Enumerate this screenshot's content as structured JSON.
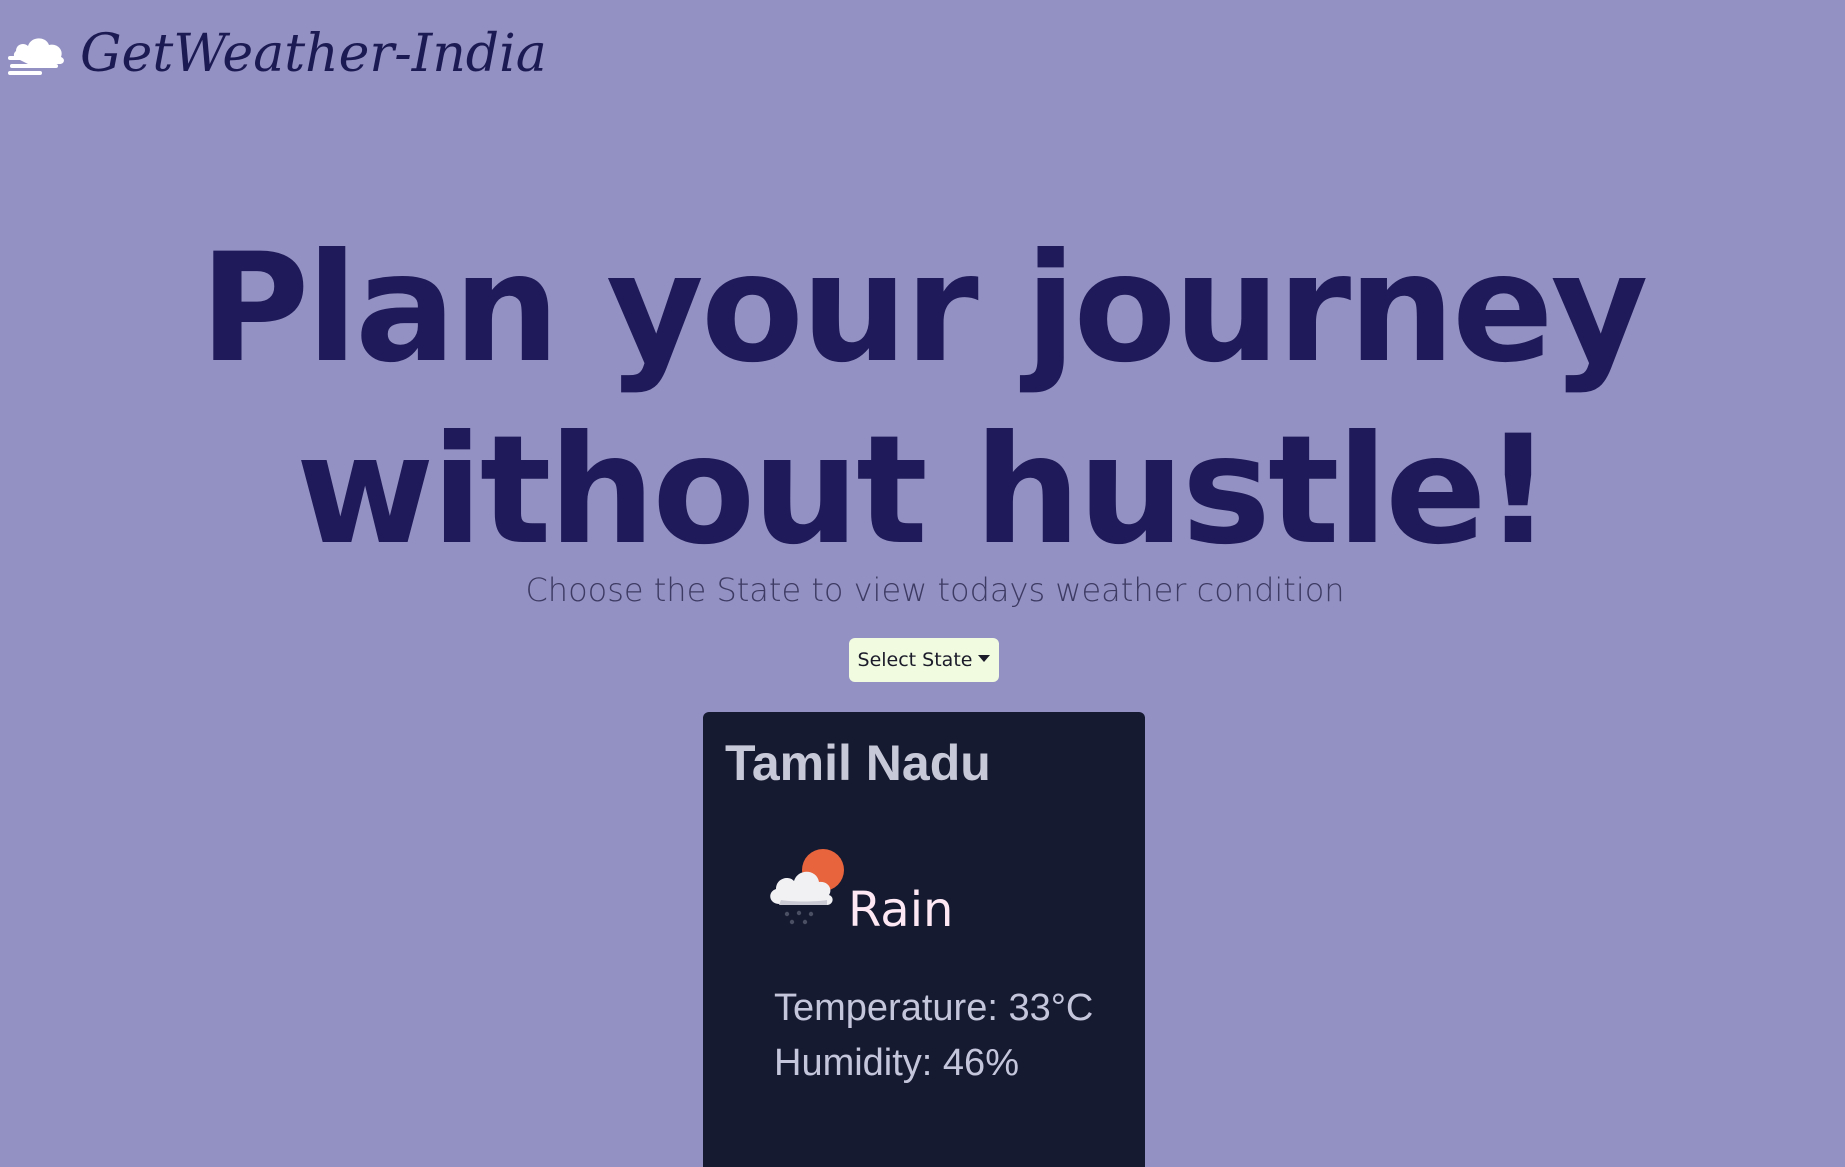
{
  "brand": {
    "name": "GetWeather-India",
    "logo_icon": "cloud-wind-icon"
  },
  "hero": {
    "line1": "Plan your journey",
    "line2": "without hustle!"
  },
  "subtitle": "Choose the State to view todays weather condition",
  "select": {
    "label": "Select State",
    "icon": "caret-down-icon"
  },
  "weather_card": {
    "state": "Tamil Nadu",
    "condition_icon": "cloud-rain-sun-icon",
    "condition": "Rain",
    "temperature": "Temperature: 33°C",
    "humidity": "Humidity: 46%"
  },
  "colors": {
    "background": "#9391c3",
    "heading": "#1f1b5a",
    "button_bg": "#f0fbe0",
    "card_bg": "#161a30",
    "sun": "#e8643c"
  }
}
